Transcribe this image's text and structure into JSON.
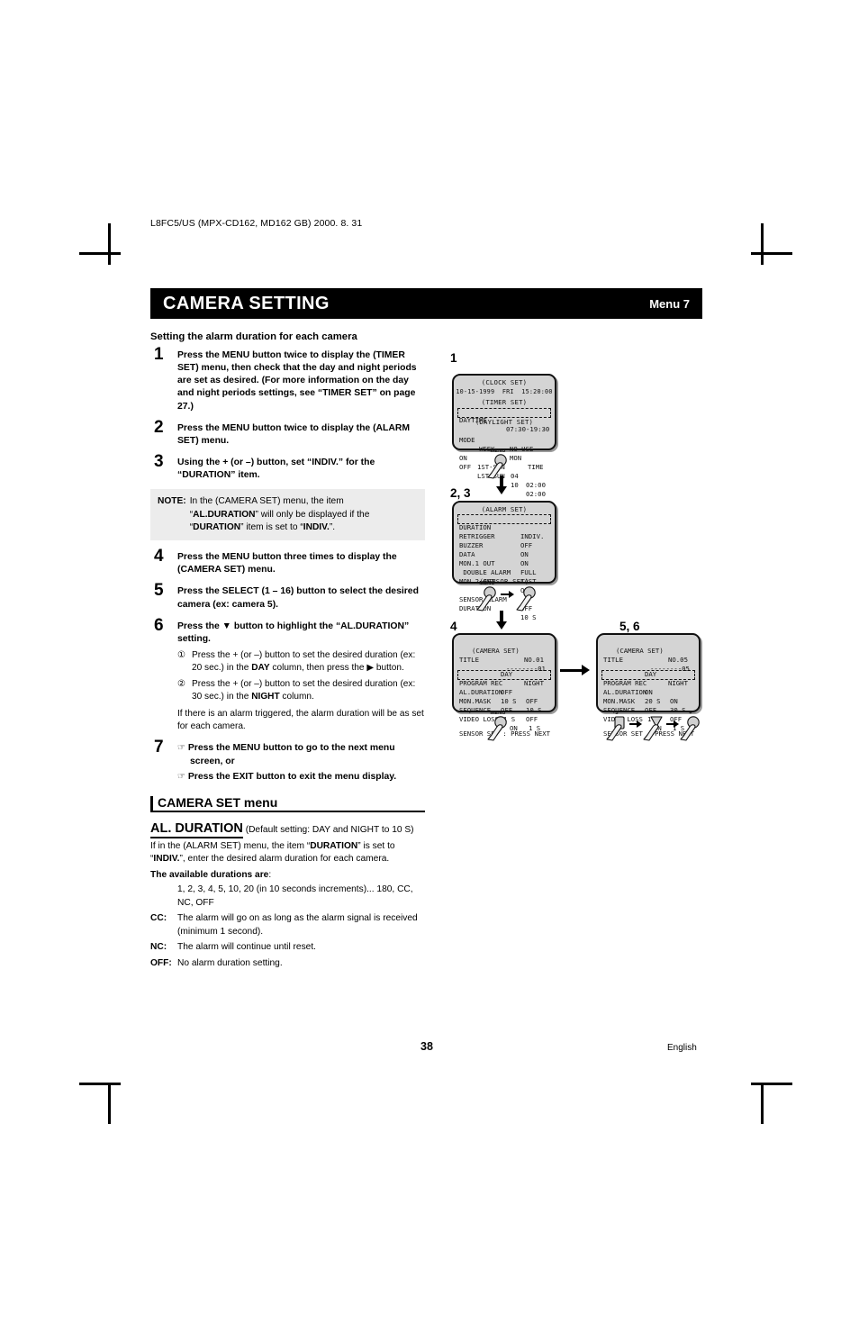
{
  "document": {
    "code_line": "L8FC5/US (MPX-CD162, MD162 GB) 2000. 8. 31",
    "page_number": "38",
    "language": "English"
  },
  "header": {
    "title": "CAMERA SETTING",
    "menu_label": "Menu 7"
  },
  "section": {
    "heading": "Setting the alarm duration for each camera"
  },
  "steps": [
    {
      "num": "1",
      "text": "Press the MENU button twice to display the (TIMER SET) menu, then check that the day and night periods are set as desired. (For more information on the day and night periods settings, see “TIMER SET” on page 27.)"
    },
    {
      "num": "2",
      "text": "Press the MENU button twice to display the (ALARM SET) menu."
    },
    {
      "num": "3",
      "text": "Using the + (or –) button, set “INDIV.” for the “DURATION” item."
    },
    {
      "num": "4",
      "text": "Press the MENU button three times to display the (CAMERA SET) menu."
    },
    {
      "num": "5",
      "text": "Press the SELECT (1 – 16) button to select the desired camera (ex: camera 5)."
    },
    {
      "num": "6",
      "text": "Press the ▼ button to highlight the “AL.DURATION” setting."
    },
    {
      "num": "7",
      "text": ""
    }
  ],
  "note": {
    "label": "NOTE:",
    "text_a": "In the (CAMERA SET) menu, the item ",
    "bold_a": "AL.DURATION",
    "text_b": " will only be displayed if the ",
    "bold_b": "DURATION",
    "text_c": " item is set to ",
    "bold_c": "INDIV.",
    "full": "In the (CAMERA SET) menu, the item “AL.DURATION” will only be displayed if the “DURATION” item is set to “INDIV.”."
  },
  "step6_sub": [
    {
      "marker": "①",
      "text_1": "Press the + (or –) button to set the desired duration (ex: 20 sec.) in the ",
      "bold": "DAY",
      "text_2": " column, then press the ▶ button."
    },
    {
      "marker": "②",
      "text_1": "Press the + (or –) button to set the desired duration (ex: 30 sec.) in the ",
      "bold": "NIGHT",
      "text_2": " column."
    }
  ],
  "step6_footnote": "If there is an alarm triggered, the alarm duration will be as set for each camera.",
  "step7_bullets": [
    "Press the MENU button to go to the next menu screen, or",
    "Press the EXIT button to exit the menu display."
  ],
  "camera_set_menu": {
    "heading": "CAMERA SET menu",
    "item_title": "AL. DURATION",
    "item_default": "(Default setting: DAY and NIGHT to 10 S)",
    "desc_1": "If in the (ALARM SET) menu, the item “",
    "desc_bold": "DURATION",
    "desc_2": "” is set to “",
    "desc_bold2": "INDIV.",
    "desc_3": "”, enter the desired alarm duration for each camera.",
    "available_label": "The available durations are",
    "available_values": "1, 2, 3, 4, 5, 10, 20 (in 10 seconds increments)... 180, CC, NC, OFF",
    "definitions": [
      {
        "key": "CC",
        "sep": ":",
        "text": "The alarm will go on as long as the alarm signal is received (minimum 1 second)."
      },
      {
        "key": "NC",
        "sep": ":",
        "text": "The alarm will continue until reset."
      },
      {
        "key": "OFF",
        "sep": ":",
        "text": "No alarm duration setting."
      }
    ]
  },
  "osd_screens": {
    "screen1": {
      "step_label": "1",
      "clock_title": "(CLOCK SET)",
      "clock_value": "10-15-1999  FRI  15:20:00",
      "timer_title": "(TIMER SET)",
      "timer_row_label": "DAYTIME",
      "timer_row_value": "07:30-19:30",
      "daylight_title": "(DAYLIGHT SET)",
      "mode_label": "MODE",
      "mode_value": "NO USE",
      "col_week": "WEEK",
      "col_mon": "MON",
      "col_time": "TIME",
      "rows": [
        {
          "label": "ON",
          "week": "1ST-SUN",
          "mon": "04",
          "time": "02:00"
        },
        {
          "label": "OFF",
          "week": "LST-SUN",
          "mon": "10",
          "time": "02:00"
        }
      ]
    },
    "screen2": {
      "step_label": "2, 3",
      "title": "(ALARM SET)",
      "rows": [
        {
          "label": "DURATION",
          "value": "INDIV."
        },
        {
          "label": "RETRIGGER",
          "value": "OFF"
        },
        {
          "label": "BUZZER",
          "value": "ON"
        },
        {
          "label": "DATA",
          "value": "ON"
        },
        {
          "label": "MON.1 OUT",
          "value": "FULL"
        },
        {
          "label": " DOUBLE ALARM",
          "value": "LAST"
        },
        {
          "label": "MON.2 OUT",
          "value": "OFF"
        }
      ],
      "subtitle": "(SENSOR SET)",
      "rows2": [
        {
          "label": "SENSOR ALARM",
          "value": "OFF"
        },
        {
          "label": "DURATION",
          "value": "10 S"
        }
      ]
    },
    "screen3": {
      "step_label": "4",
      "title": "(CAMERA SET)",
      "no_label": "NO.01",
      "title_row_label": "TITLE",
      "title_row_value": "--------01",
      "col_day": "DAY",
      "col_night": "NIGHT",
      "rows": [
        {
          "label": "PROGRAM REC",
          "day": "OFF",
          "night": "OFF"
        },
        {
          "label": "AL.DURATION",
          "day": "10 S",
          "night": "10 S"
        },
        {
          "label": "MON.MASK",
          "day": "OFF",
          "night": "OFF"
        },
        {
          "label": "SEQUENCE",
          "day": "1 S",
          "night": "1 S"
        }
      ],
      "video_loss_label": "VIDEO LOSS",
      "video_loss_value": "ON",
      "footer": "SENSOR SET : PRESS NEXT"
    },
    "screen4": {
      "step_label": "5, 6",
      "title": "(CAMERA SET)",
      "no_label": "NO.05",
      "title_row_label": "TITLE",
      "title_row_value": "--------05",
      "col_day": "DAY",
      "col_night": "NIGHT",
      "rows": [
        {
          "label": "PROGRAM REC",
          "day": "ON",
          "night": "ON"
        },
        {
          "label": "AL.DURATION",
          "day": "20 S",
          "night": "30 S"
        },
        {
          "label": "MON.MASK",
          "day": "OFF",
          "night": "OFF"
        },
        {
          "label": "SEQUENCE",
          "day": "1 S",
          "night": "1 S"
        }
      ],
      "video_loss_label": "VIDEO LOSS",
      "video_loss_value": "ON",
      "footer": "SENSOR SET : PRESS NEXT"
    }
  },
  "button_hints": {
    "menu": "MENU",
    "plus": "+",
    "select5": "5",
    "down": "▼"
  }
}
